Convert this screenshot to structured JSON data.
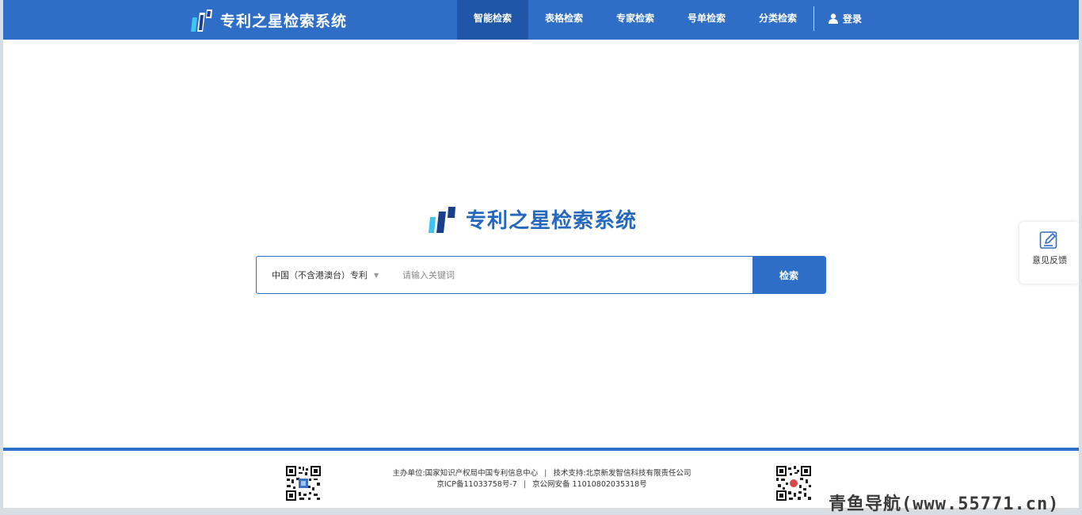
{
  "header": {
    "brand_title": "专利之星检索系统",
    "nav": [
      {
        "label": "智能检索",
        "active": true
      },
      {
        "label": "表格检索",
        "active": false
      },
      {
        "label": "专家检索",
        "active": false
      },
      {
        "label": "号单检索",
        "active": false
      },
      {
        "label": "分类检索",
        "active": false
      }
    ],
    "login_label": "登录"
  },
  "main": {
    "brand_title": "专利之星检索系统",
    "search": {
      "scope_label": "中国（不含港澳台）专利",
      "placeholder": "请输入关键词",
      "value": "",
      "button_label": "检索"
    }
  },
  "feedback": {
    "label": "意见反馈"
  },
  "footer": {
    "sponsor": "主办单位:国家知识产权局中国专利信息中心",
    "support": "技术支持:北京新发智信科技有限责任公司",
    "icp": "京ICP备11033758号-7",
    "police": "京公网安备 11010802035318号",
    "separator": "|"
  },
  "watermark": "青鱼导航(www.55771.cn)",
  "colors": {
    "primary": "#2e6ec7",
    "nav_active": "#1f56a8",
    "brand_text": "#2468bf"
  },
  "icons": [
    "logo-icon",
    "user-icon",
    "dropdown-arrow-icon",
    "edit-icon",
    "qr-code"
  ]
}
